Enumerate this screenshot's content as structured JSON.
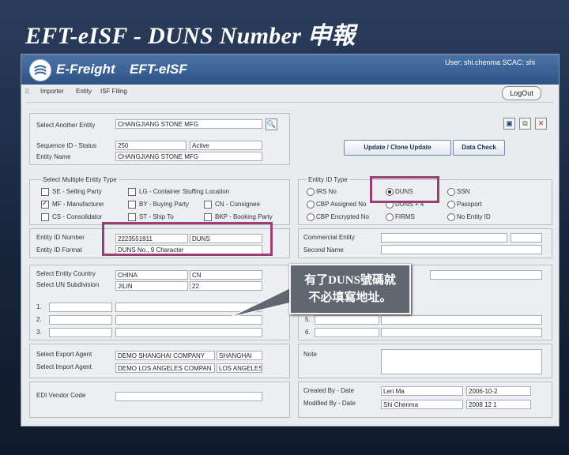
{
  "slide": {
    "title": "EFT-eISF  -  DUNS Number 申報",
    "callout_line1": "有了DUNS號碼就",
    "callout_line2": "不必填寫地址。"
  },
  "app": {
    "brand": "E-Freight",
    "product": "EFT-eISF",
    "user_info": "User: shi.chenma SCAC: shi",
    "logout_label": "LogOut",
    "menu": [
      "Importer",
      "Entity",
      "ISF Filing"
    ]
  },
  "toolbar": {
    "save_icon": "save-icon",
    "copy_icon": "copy-icon",
    "delete_icon": "delete-icon",
    "search_icon": "search-icon"
  },
  "entity": {
    "select_another_label": "Select Another Entity",
    "select_another_value": "CHANGJIANG STONE MFG",
    "sequence_label": "Sequence ID - Status",
    "sequence_value": "250",
    "status_value": "Active",
    "entity_name_label": "Entity Name",
    "entity_name_value": "CHANGJIANG STONE MFG",
    "update_button": "Update / Clone Update",
    "data_check_button": "Data Check"
  },
  "entity_type": {
    "legend": "Select Multiple Entity Type",
    "items": [
      {
        "label": "SE - Selling Party",
        "checked": false
      },
      {
        "label": "LG - Container Stuffing Location",
        "checked": false
      },
      {
        "label": "MF - Manufacturer",
        "checked": true
      },
      {
        "label": "BY - Buying Party",
        "checked": false
      },
      {
        "label": "CN - Consignee",
        "checked": false
      },
      {
        "label": "CS - Consolidator",
        "checked": false
      },
      {
        "label": "ST - Ship To",
        "checked": false
      },
      {
        "label": "BKP - Booking Party",
        "checked": false
      }
    ]
  },
  "id_type": {
    "legend": "Entity ID Type",
    "items": [
      {
        "label": "IRS No",
        "checked": false
      },
      {
        "label": "DUNS",
        "checked": true
      },
      {
        "label": "SSN",
        "checked": false
      },
      {
        "label": "CBP Assigned No",
        "checked": false
      },
      {
        "label": "DUNS + 4",
        "checked": false
      },
      {
        "label": "Passport",
        "checked": false
      },
      {
        "label": "CBP Encrypted No",
        "checked": false
      },
      {
        "label": "FIRMS",
        "checked": false
      },
      {
        "label": "No Entity ID",
        "checked": false
      }
    ]
  },
  "entity_id": {
    "number_label": "Entity ID Number",
    "number_value": "2223551911",
    "type_value": "DUNS",
    "format_label": "Entity ID Format",
    "format_value": "DUNS No., 9 Character",
    "commercial_label": "Commercial Entity",
    "second_name_label": "Second Name"
  },
  "address": {
    "country_label": "Select Entity Country",
    "country_value": "CHINA",
    "country_code": "CN",
    "subdivision_label": "Select UN Subdivision",
    "subdivision_value": "JILIN",
    "subdivision_code": "22",
    "rows": [
      "1.",
      "2.",
      "3."
    ],
    "rows_right": [
      "5.",
      "6."
    ]
  },
  "agents": {
    "export_label": "Select Export Agent",
    "export_value": "DEMO SHANGHAI COMPANY",
    "export_city": "SHANGHAI",
    "import_label": "Select Import Agent",
    "import_value": "DEMO LOS ANGELES COMPAN",
    "import_city": "LOS ANGELES",
    "note_label": "Note"
  },
  "audit": {
    "edi_label": "EDI Vendor Code",
    "created_label": "Created By - Date",
    "created_by": "Leri Ma",
    "created_date": "2006-10-2",
    "modified_label": "Modified By - Date",
    "modified_by": "Shi Chenma",
    "modified_date": "2008 12 1"
  }
}
